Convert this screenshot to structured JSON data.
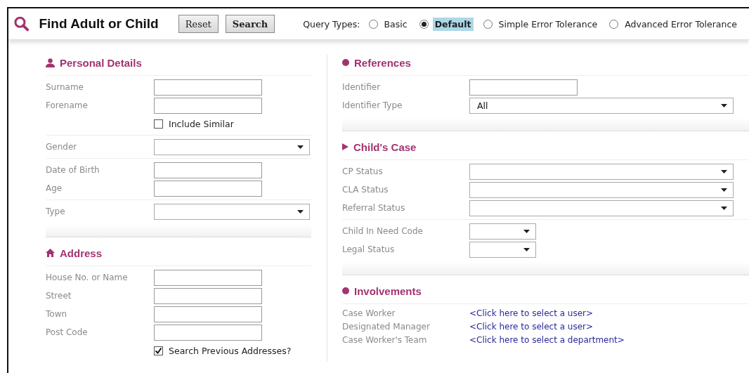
{
  "header": {
    "title": "Find Adult or Child",
    "buttons": [
      {
        "label": "Reset",
        "kind": "plain"
      },
      {
        "label": "Search",
        "kind": "primary"
      }
    ],
    "query_label": "Query Types:",
    "query_types": [
      {
        "label": "Basic",
        "selected": false
      },
      {
        "label": "Default",
        "selected": true
      },
      {
        "label": "Simple Error Tolerance",
        "selected": false
      },
      {
        "label": "Advanced Error Tolerance",
        "selected": false
      }
    ]
  },
  "columns": [
    {
      "sections": [
        {
          "title": "Personal Details",
          "groups": [
            [
              {
                "label": "Surname",
                "kind": "input"
              },
              {
                "label": "Forename",
                "kind": "input"
              },
              {
                "label": "Include Similar",
                "kind": "checkbox",
                "checked": false
              }
            ],
            [
              {
                "label": "Gender",
                "kind": "select"
              }
            ],
            [
              {
                "label": "Date of Birth",
                "kind": "input"
              },
              {
                "label": "Age",
                "kind": "input"
              }
            ],
            [
              {
                "label": "Type",
                "kind": "select"
              }
            ]
          ]
        },
        {
          "title": "Address",
          "groups": [
            [
              {
                "label": "House No. or Name",
                "kind": "input"
              },
              {
                "label": "Street",
                "kind": "input"
              },
              {
                "label": "Town",
                "kind": "input"
              },
              {
                "label": "Post Code",
                "kind": "input"
              },
              {
                "label": "Search Previous Addresses?",
                "kind": "checkbox",
                "checked": true
              }
            ]
          ]
        }
      ]
    },
    {
      "sections": [
        {
          "title": "References",
          "groups": [
            [
              {
                "label": "Identifier",
                "kind": "input"
              },
              {
                "label": "Identifier Type",
                "kind": "select",
                "value": "All"
              }
            ]
          ]
        },
        {
          "title": "Child's Case",
          "groups": [
            [
              {
                "label": "CP Status",
                "kind": "select"
              },
              {
                "label": "CLA Status",
                "kind": "select"
              },
              {
                "label": "Referral Status",
                "kind": "select"
              }
            ],
            [
              {
                "label": "Child In Need Code",
                "kind": "short_select"
              },
              {
                "label": "Legal Status",
                "kind": "short_select"
              }
            ]
          ]
        },
        {
          "title": "Involvements",
          "groups": [
            [
              {
                "label": "Case Worker",
                "kind": "link",
                "value": "<Click here to select a user>"
              },
              {
                "label": "Designated Manager",
                "kind": "link",
                "value": "<Click here to select a user>"
              },
              {
                "label": "Case Worker's Team",
                "kind": "link",
                "value": "<Click here to select a department>"
              }
            ]
          ]
        }
      ]
    }
  ]
}
